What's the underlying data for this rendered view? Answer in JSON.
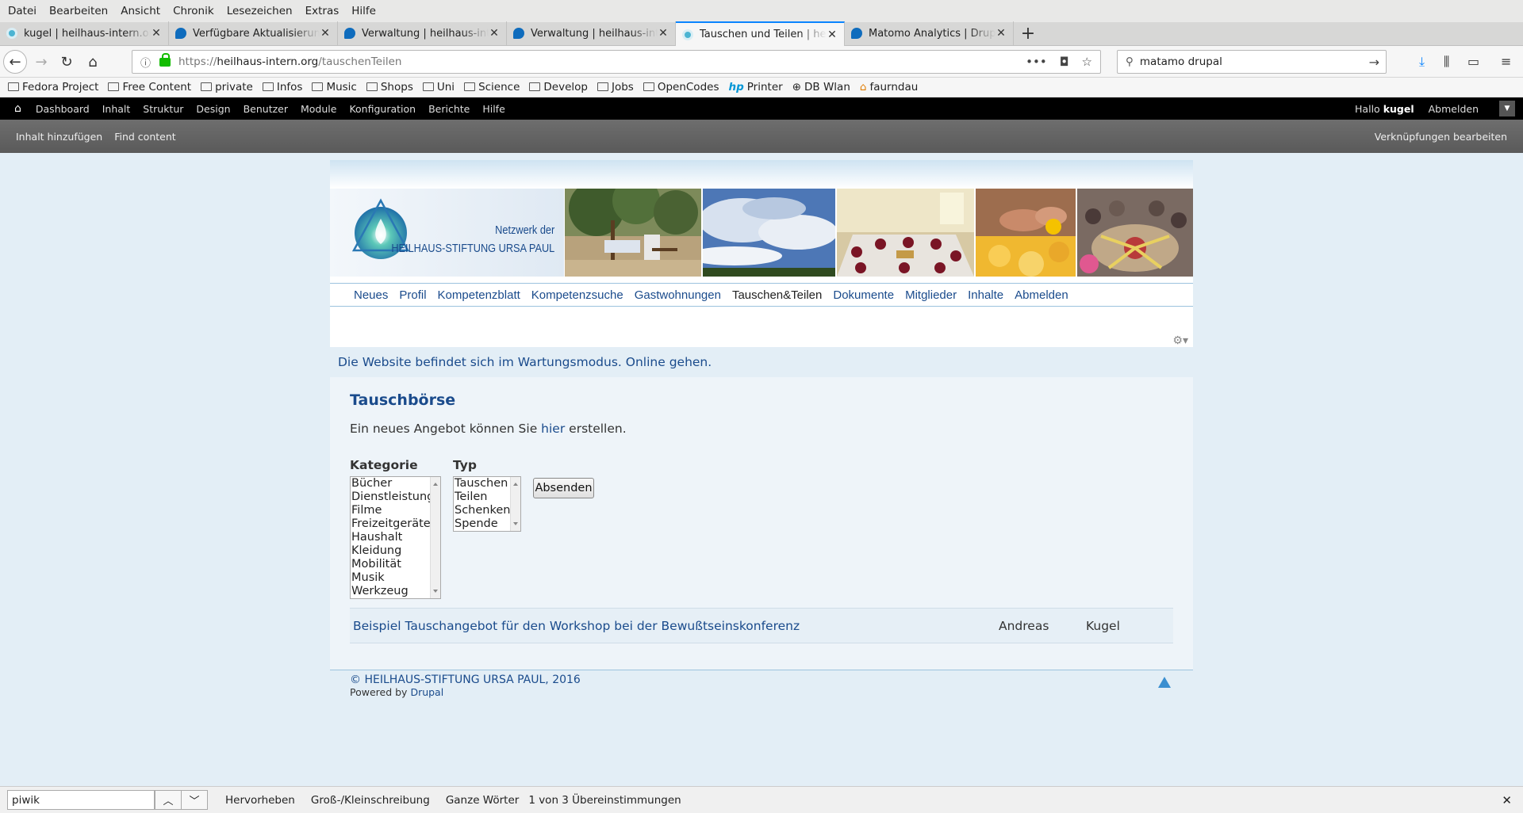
{
  "menubar": [
    "Datei",
    "Bearbeiten",
    "Ansicht",
    "Chronik",
    "Lesezeichen",
    "Extras",
    "Hilfe"
  ],
  "tabs": [
    {
      "title": "kugel | heilhaus-intern.org",
      "icon": "heilhaus-icon"
    },
    {
      "title": "Verfügbare Aktualisierungen",
      "icon": "drupal-icon"
    },
    {
      "title": "Verwaltung | heilhaus-intern",
      "icon": "drupal-icon"
    },
    {
      "title": "Verwaltung | heilhaus-intern",
      "icon": "drupal-icon"
    },
    {
      "title": "Tauschen und Teilen | heilhaus",
      "icon": "heilhaus-icon",
      "active": true
    },
    {
      "title": "Matomo Analytics | Drupal",
      "icon": "drupal-icon"
    }
  ],
  "url": {
    "scheme": "https://",
    "host": "heilhaus-intern.org",
    "path": "/tauschenTeilen"
  },
  "search": {
    "value": "matamo drupal"
  },
  "bookmarks": [
    "Fedora Project",
    "Free Content",
    "private",
    "Infos",
    "Music",
    "Shops",
    "Uni",
    "Science",
    "Develop",
    "Jobs",
    "OpenCodes",
    "Printer",
    "DB Wlan",
    "faurndau"
  ],
  "drupal_toolbar": {
    "items": [
      "Dashboard",
      "Inhalt",
      "Struktur",
      "Design",
      "Benutzer",
      "Module",
      "Konfiguration",
      "Berichte",
      "Hilfe"
    ],
    "greeting": "Hallo",
    "user": "kugel",
    "logout": "Abmelden"
  },
  "shortcuts": {
    "items": [
      "Inhalt hinzufügen",
      "Find content"
    ],
    "edit": "Verknüpfungen bearbeiten"
  },
  "brand": {
    "line1": "Netzwerk der",
    "line2": "HEILHAUS-STIFTUNG URSA PAUL"
  },
  "main_nav": [
    "Neues",
    "Profil",
    "Kompetenzblatt",
    "Kompetenzsuche",
    "Gastwohnungen",
    "Tauschen&Teilen",
    "Dokumente",
    "Mitglieder",
    "Inhalte",
    "Abmelden"
  ],
  "maintenance": "Die Website befindet sich im Wartungsmodus. Online gehen.",
  "page_title": "Tauschbörse",
  "intro": {
    "before": "Ein neues Angebot können Sie",
    "link": "hier",
    "after": "erstellen."
  },
  "filters": {
    "category_label": "Kategorie",
    "categories": [
      "Bücher",
      "Dienstleistung",
      "Filme",
      "Freizeitgeräte",
      "Haushalt",
      "Kleidung",
      "Mobilität",
      "Musik",
      "Werkzeug"
    ],
    "type_label": "Typ",
    "types": [
      "Tauschen",
      "Teilen",
      "Schenken",
      "Spende"
    ],
    "submit": "Absenden"
  },
  "results": [
    {
      "title": "Beispiel Tauschangebot für den Workshop bei der Bewußtseinskonferenz",
      "first": "Andreas",
      "last": "Kugel"
    }
  ],
  "footer": {
    "copyright": "© HEILHAUS-STIFTUNG URSA PAUL, 2016",
    "powered": "Powered by",
    "powered_link": "Drupal"
  },
  "findbar": {
    "value": "piwik",
    "highlight": "Hervorheben",
    "case": "Groß-/Kleinschreibung",
    "words": "Ganze Wörter",
    "status": "1 von 3 Übereinstimmungen"
  },
  "colors": {
    "link": "#1a4b8c",
    "page_bg": "#e3eef6",
    "accent": "#0a84ff"
  }
}
